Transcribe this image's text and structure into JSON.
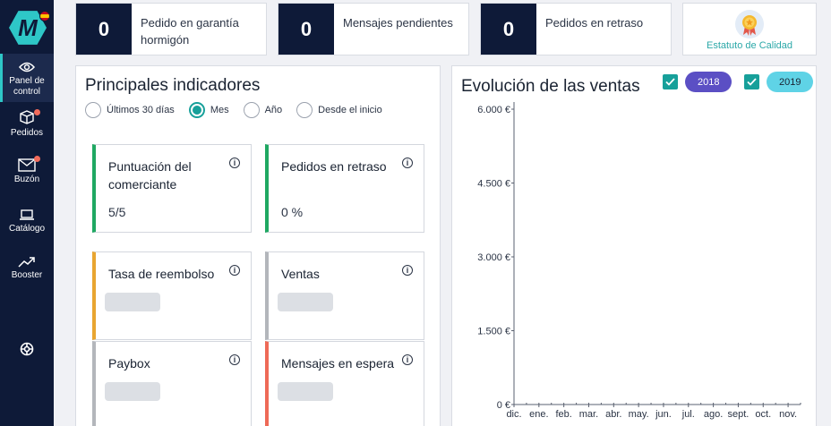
{
  "logo": {
    "letter": "M"
  },
  "nav": [
    {
      "label": "Panel de control",
      "icon": "eye-icon",
      "active": true
    },
    {
      "label": "Pedidos",
      "icon": "box-icon",
      "badge": true
    },
    {
      "label": "Buzón",
      "icon": "mail-icon",
      "badge": true
    },
    {
      "label": "Catálogo",
      "icon": "catalog-icon"
    },
    {
      "label": "Booster",
      "icon": "trend-icon"
    },
    {
      "label": "",
      "icon": "support-icon"
    }
  ],
  "stats": [
    {
      "value": "0",
      "label": "Pedido en garantía hormigón"
    },
    {
      "value": "0",
      "label": "Mensajes pendientes"
    },
    {
      "value": "0",
      "label": "Pedidos en retraso"
    }
  ],
  "quality": {
    "label": "Estatuto de Calidad"
  },
  "indicators": {
    "title": "Principales indicadores",
    "periods": [
      {
        "label": "Últimos 30 días",
        "selected": false
      },
      {
        "label": "Mes",
        "selected": true
      },
      {
        "label": "Año",
        "selected": false
      },
      {
        "label": "Desde el inicio",
        "selected": false
      }
    ],
    "cards": [
      {
        "title": "Puntuación del comerciante",
        "value": "5/5",
        "color": "#1fa862"
      },
      {
        "title": "Pedidos en retraso",
        "value": "0 %",
        "color": "#1fa862"
      },
      {
        "title": "Tasa de reembolso",
        "value": "",
        "color": "#e8a531"
      },
      {
        "title": "Ventas",
        "value": "",
        "color": "#b3b6bb"
      },
      {
        "title": "Paybox",
        "value": "",
        "color": "#b3b6bb"
      },
      {
        "title": "Mensajes en espera",
        "value": "",
        "color": "#ee6a57"
      }
    ]
  },
  "sales": {
    "title": "Evolución de las ventas",
    "legend": [
      {
        "label": "2018",
        "color": "#5b4fc4",
        "text_color": "#ffffff"
      },
      {
        "label": "2019",
        "color": "#5fd3e6",
        "text_color": "#1a2332"
      }
    ]
  },
  "chart_data": {
    "type": "line",
    "title": "Evolución de las ventas",
    "categories": [
      "dic.",
      "ene.",
      "feb.",
      "mar.",
      "abr.",
      "may.",
      "jun.",
      "jul.",
      "ago.",
      "sept.",
      "oct.",
      "nov."
    ],
    "y_ticks": [
      "0 €",
      "1.500 €",
      "3.000 €",
      "4.500 €",
      "6.000 €"
    ],
    "ylim": [
      0,
      6000
    ],
    "series": [
      {
        "name": "2018",
        "values": []
      },
      {
        "name": "2019",
        "values": []
      }
    ]
  }
}
